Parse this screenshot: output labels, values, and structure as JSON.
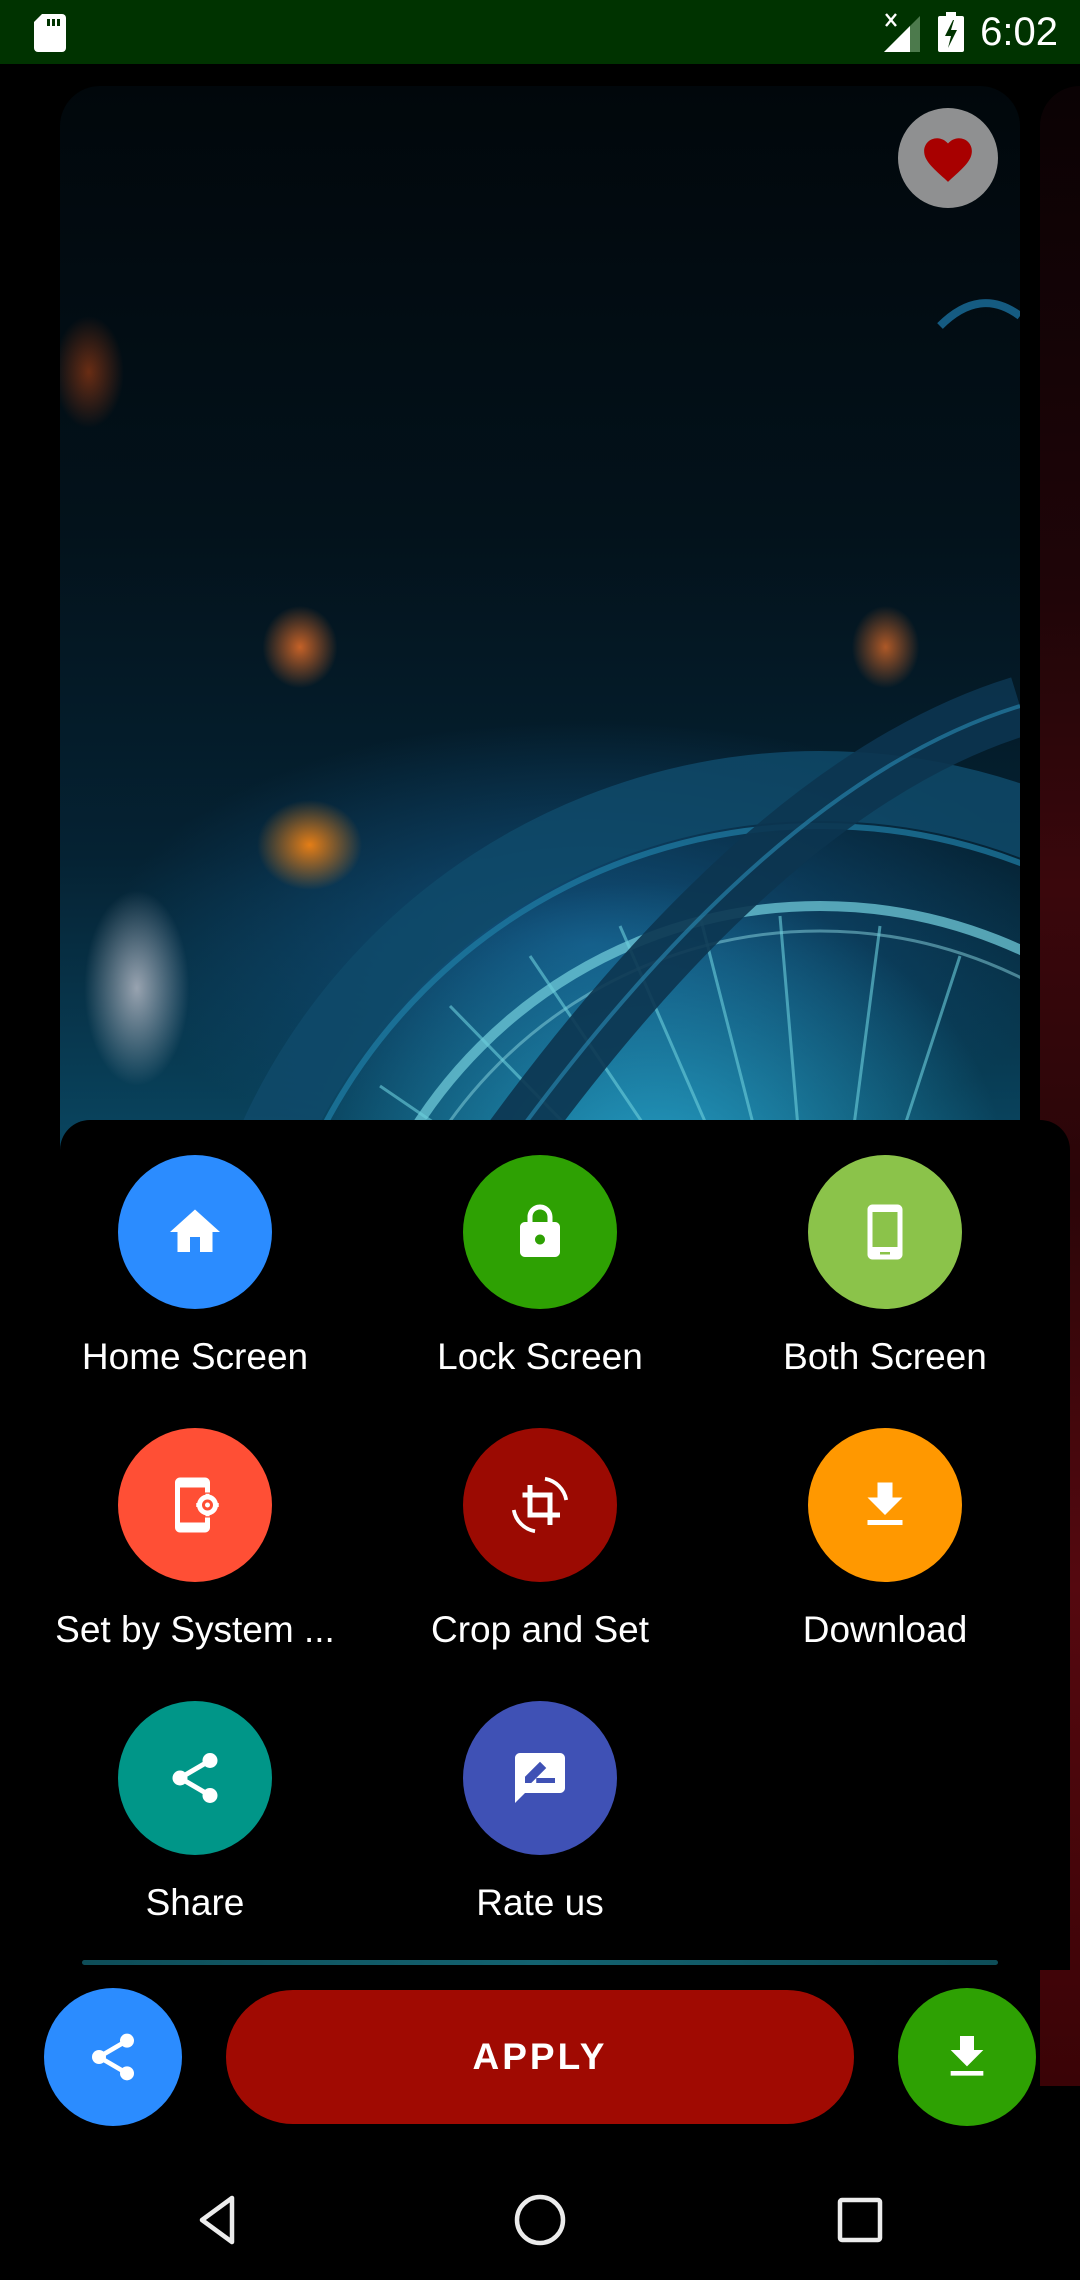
{
  "status_bar": {
    "time": "6:02",
    "icons": [
      "sd-card-icon",
      "signal-no-data-icon",
      "battery-charging-icon"
    ]
  },
  "wallpaper": {
    "description": "Bicycle wheel with bokeh lights, blue tones",
    "favorite_icon": "heart-icon",
    "favorited": true
  },
  "actions": [
    {
      "label": "Home Screen",
      "icon": "home-icon",
      "color": "#2b8cff"
    },
    {
      "label": "Lock Screen",
      "icon": "lock-icon",
      "color": "#2ea103"
    },
    {
      "label": "Both Screen",
      "icon": "smartphone-icon",
      "color": "#8bc34a"
    },
    {
      "label": "Set by System ...",
      "icon": "phone-settings-icon",
      "color": "#ff4f35"
    },
    {
      "label": "Crop and Set",
      "icon": "crop-rotate-icon",
      "color": "#9b0a02"
    },
    {
      "label": "Download",
      "icon": "download-icon",
      "color": "#ff9800"
    },
    {
      "label": "Share",
      "icon": "share-icon",
      "color": "#009688"
    },
    {
      "label": "Rate us",
      "icon": "rate-review-icon",
      "color": "#3f51b5"
    }
  ],
  "bottom_bar": {
    "share_icon": "share-icon",
    "apply_label": "APPLY",
    "download_icon": "download-icon",
    "colors": {
      "share": "#2b8cff",
      "apply": "#a00a02",
      "download": "#2ea103"
    }
  },
  "nav_bar": {
    "buttons": [
      "back",
      "home",
      "recents"
    ]
  }
}
